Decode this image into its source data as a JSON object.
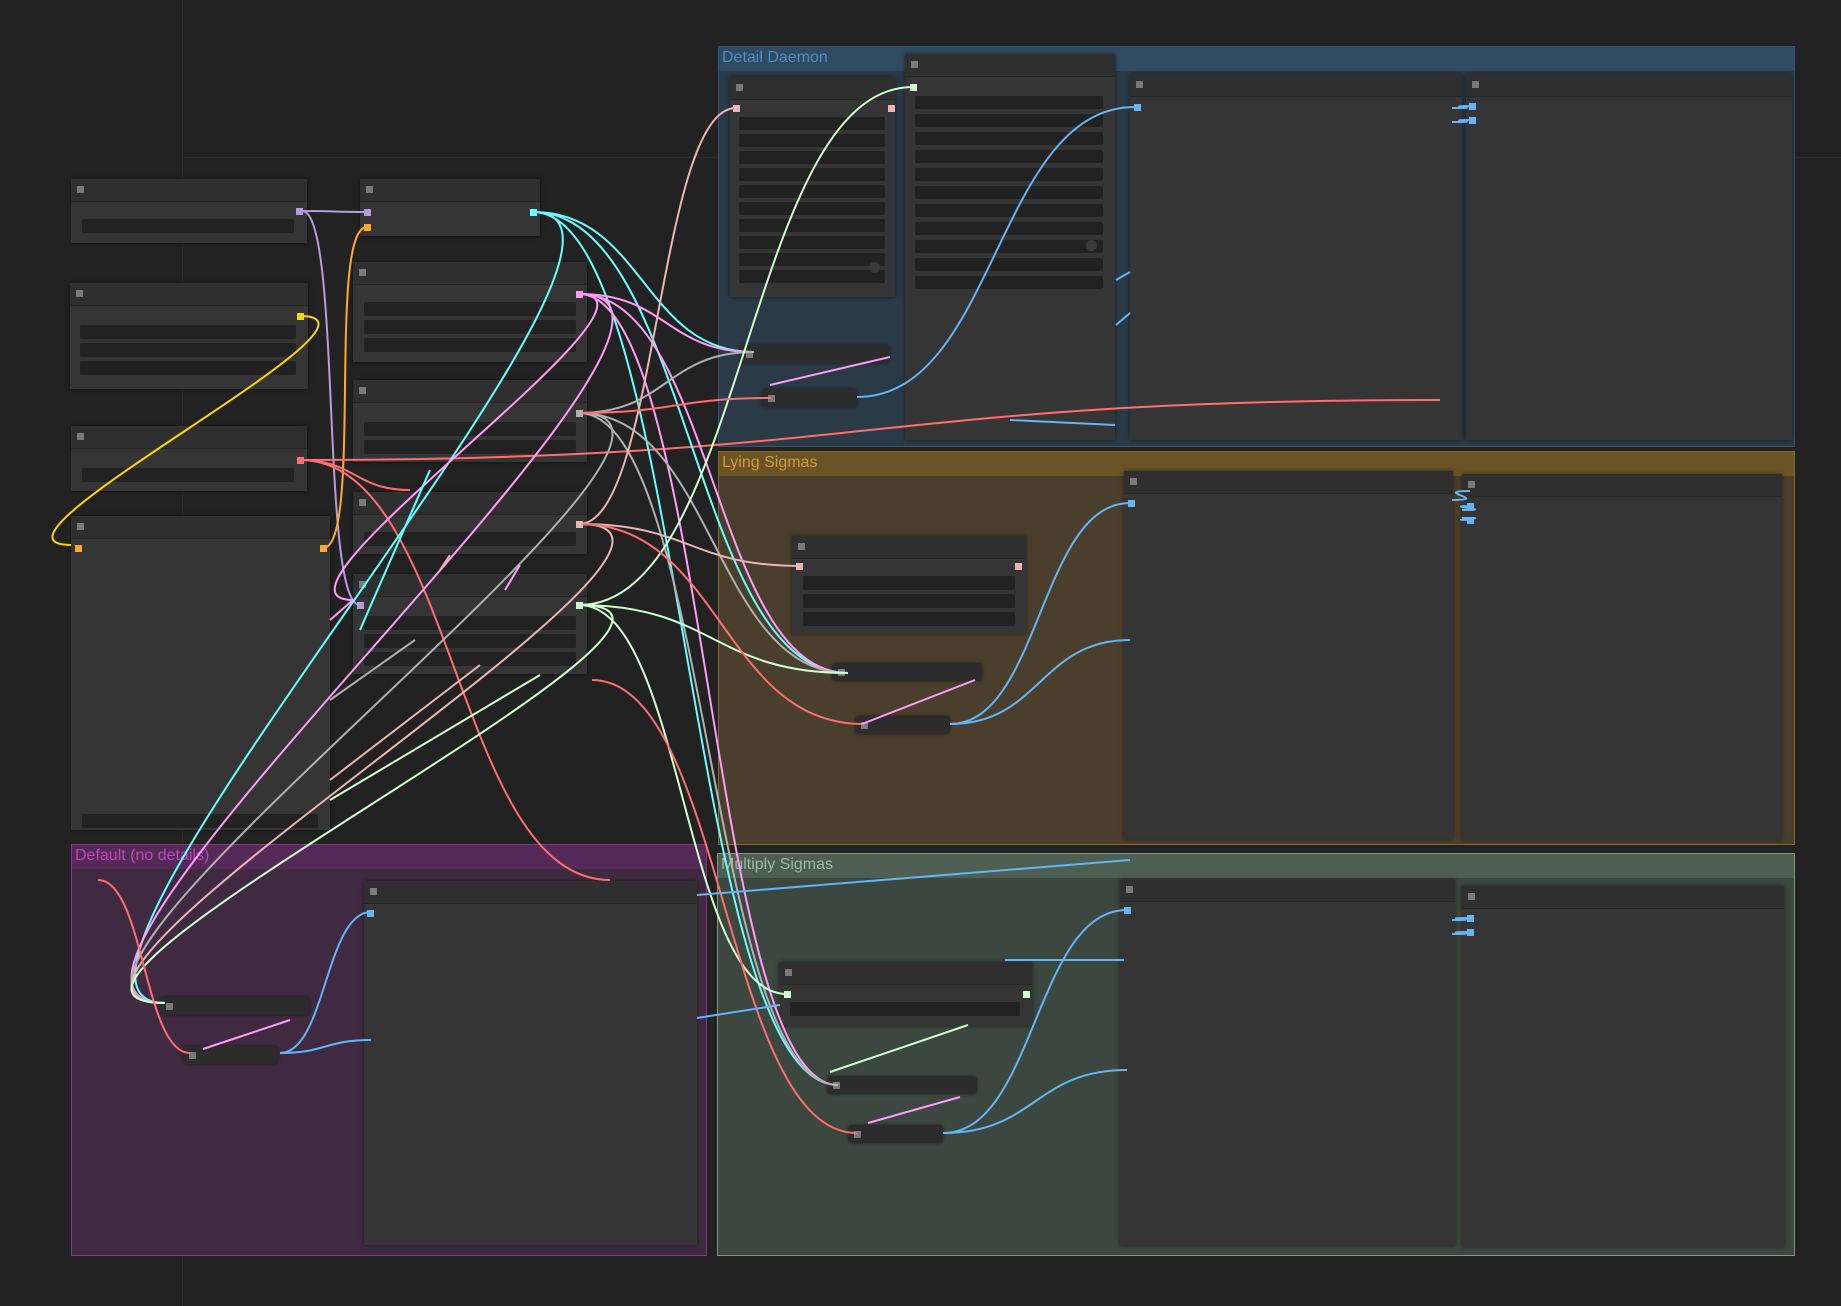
{
  "groups": {
    "detail_daemon": {
      "title": "Detail Daemon",
      "color": "#335577"
    },
    "lying_sigmas": {
      "title": "Lying Sigmas",
      "color": "#b58b2a"
    },
    "default": {
      "title": "Default (no details)",
      "color": "#a1309b"
    },
    "multiply_sigmas": {
      "title": "Multiply Sigmas",
      "color": "#8aa88a"
    }
  },
  "wire_colors": {
    "model": "#b39ddb",
    "clip": "#ffd500",
    "vae": "#ff6e6e",
    "conditioning": "#ffa931",
    "latent": "#ff9cf9",
    "sigmas": "#cdffcd",
    "sampler": "#ecb4b4",
    "noise": "#b0b0b0",
    "guider": "#66ffff",
    "image": "#64b5f6"
  },
  "icons": {
    "node_collapse": "collapse-square-icon",
    "slot": "slot-square-icon",
    "resize": "resize-corner-icon"
  }
}
